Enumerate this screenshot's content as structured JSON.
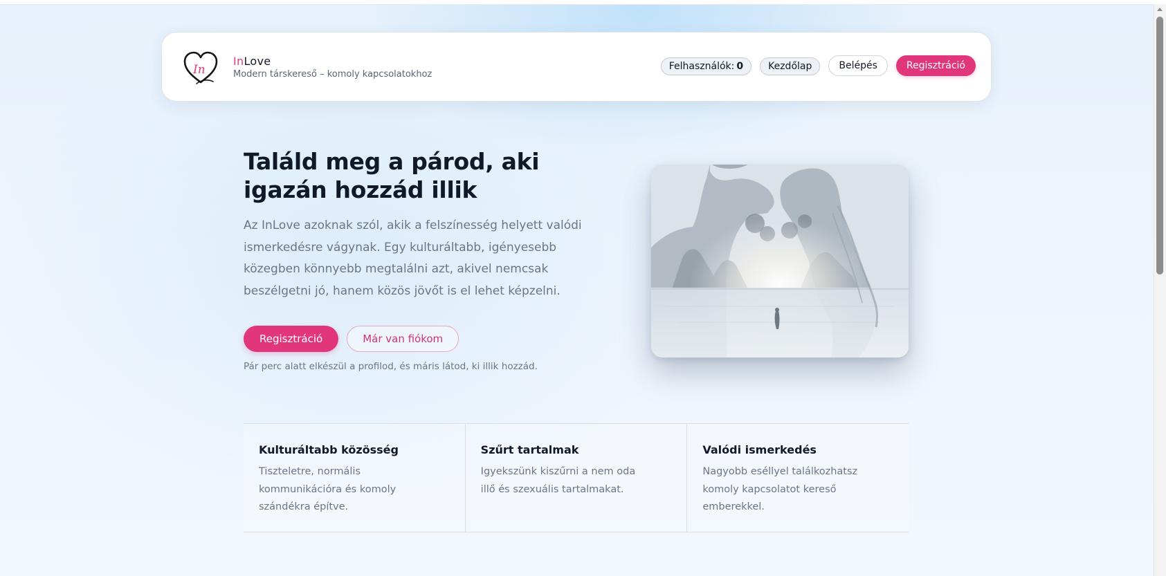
{
  "header": {
    "brand_prefix": "In",
    "brand_suffix": "Love",
    "tagline": "Modern társkereső – komoly kapcsolatokhoz",
    "logo_text": "In",
    "nav": {
      "users_label": "Felhasználók:",
      "users_count": "0",
      "home": "Kezdőlap",
      "login": "Belépés",
      "register": "Regisztráció"
    }
  },
  "hero": {
    "title": "Találd meg a párod, aki igazán hozzád illik",
    "description": "Az InLove azoknak szól, akik a felszínesség helyett valódi ismerkedésre vágynak. Egy kulturáltabb, igényesebb közegben könnyebb megtalálni azt, akivel nemcsak beszélgetni jó, hanem közös jövőt is el lehet képzelni.",
    "primary_button": "Regisztráció",
    "secondary_button": "Már van fiókom",
    "note": "Pár perc alatt elkészül a profilod, és máris látod, ki illik hozzád."
  },
  "features": [
    {
      "title": "Kulturáltabb közösség",
      "text": "Tiszteletre, normális kommunikációra és komoly szándékra építve."
    },
    {
      "title": "Szűrt tartalmak",
      "text": "Igyekszünk kiszűrni a nem oda illő és szexuális tartalmakat."
    },
    {
      "title": "Valódi ismerkedés",
      "text": "Nagyobb eséllyel találkozhatsz komoly kapcsolatot kereső emberekkel."
    }
  ],
  "colors": {
    "accent": "#e2367a",
    "text_dark": "#111827",
    "text_muted": "#6b7585"
  },
  "icons": {
    "logo": "heart-logo-icon"
  }
}
